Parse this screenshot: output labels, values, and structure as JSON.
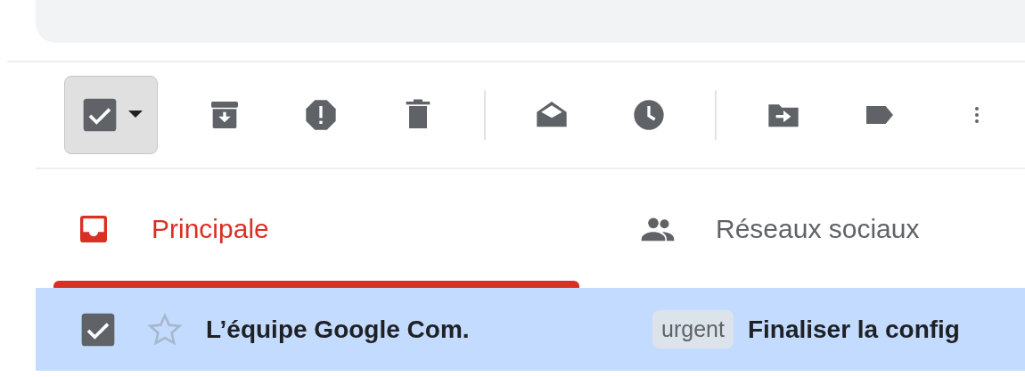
{
  "toolbar": {
    "select_all": {
      "checked": true
    }
  },
  "tabs": [
    {
      "label": "Principale",
      "selected": true,
      "kind": "inbox"
    },
    {
      "label": "Réseaux sociaux",
      "selected": false,
      "kind": "people"
    }
  ],
  "rows": [
    {
      "selected": true,
      "checked": true,
      "starred": false,
      "sender": "L’équipe Google Com.",
      "label": "urgent",
      "subject": "Finaliser la config"
    }
  ]
}
